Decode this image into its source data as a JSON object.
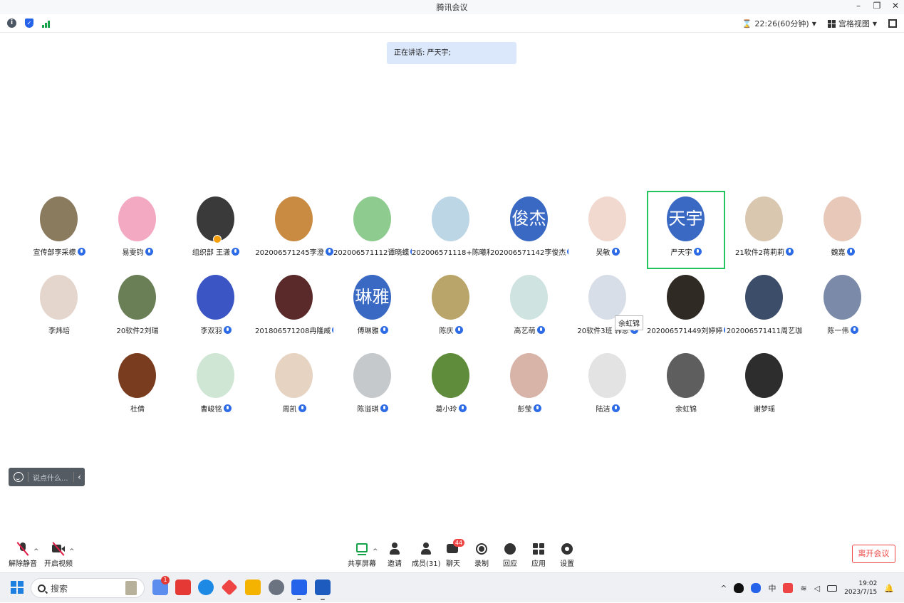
{
  "window": {
    "title": "腾讯会议",
    "controls": [
      "–",
      "❐",
      "✕"
    ]
  },
  "toolbar": {
    "timer": "22:26(60分钟)",
    "view": "宫格视图"
  },
  "speaking": {
    "text": "正在讲话: 严天宇;"
  },
  "participants": [
    {
      "name": "宣传部李采檬",
      "mic": true,
      "avatar_color": "#8a7a5e"
    },
    {
      "name": "易雯钧",
      "mic": true,
      "avatar_color": "#f3a9c2"
    },
    {
      "name": "组织部 王潇",
      "mic": true,
      "avatar_color": "#3a3a3a",
      "host": true
    },
    {
      "name": "202006571245李澄",
      "mic": true,
      "avatar_color": "#c98a42"
    },
    {
      "name": "202006571112谭晓蝶",
      "mic": true,
      "avatar_color": "#8ecb8f"
    },
    {
      "name": "202006571118+陈曦和",
      "mic": false,
      "avatar_color": "#bcd6e6"
    },
    {
      "name": "202006571142李俊杰",
      "mic": true,
      "avatar_text": "俊杰"
    },
    {
      "name": "吴敏",
      "mic": true,
      "avatar_color": "#f2d9cf"
    },
    {
      "name": "严天宇",
      "mic": true,
      "avatar_text": "天宇",
      "active": true
    },
    {
      "name": "21软件2蒋莉莉",
      "mic": true,
      "avatar_color": "#d9c7b0"
    },
    {
      "name": "魏嘉",
      "mic": true,
      "avatar_color": "#e8c8b8"
    },
    {
      "name": "李炜培",
      "mic": false,
      "avatar_color": "#e4d6cc"
    },
    {
      "name": "20软件2刘瑞",
      "mic": false,
      "avatar_color": "#6b7f56"
    },
    {
      "name": "李双羽",
      "mic": true,
      "avatar_color": "#3b56c4"
    },
    {
      "name": "201806571208冉隆威",
      "mic": true,
      "avatar_color": "#5a2a2a"
    },
    {
      "name": "傅琳雅",
      "mic": true,
      "avatar_text": "琳雅"
    },
    {
      "name": "陈庆",
      "mic": true,
      "avatar_color": "#b9a46a"
    },
    {
      "name": "高艺萌",
      "mic": true,
      "avatar_color": "#cfe3e0"
    },
    {
      "name": "20软件3班 韩思",
      "mic": true,
      "avatar_color": "#d8dee8"
    },
    {
      "name": "202006571449刘婷婷",
      "mic": true,
      "avatar_color": "#2f2a24"
    },
    {
      "name": "202006571411周艺珈",
      "mic": false,
      "avatar_color": "#3c4d6a"
    },
    {
      "name": "陈一伟",
      "mic": true,
      "avatar_color": "#7a8aa8"
    },
    {
      "name": "杜倩",
      "mic": false,
      "avatar_color": "#7a3c1e"
    },
    {
      "name": "曹峻铭",
      "mic": true,
      "avatar_color": "#cfe6d4"
    },
    {
      "name": "周凯",
      "mic": true,
      "avatar_color": "#e6d3c2"
    },
    {
      "name": "陈溢琪",
      "mic": true,
      "avatar_color": "#c6c9cc"
    },
    {
      "name": "葛小玲",
      "mic": true,
      "avatar_color": "#5f8c3a"
    },
    {
      "name": "彭莹",
      "mic": true,
      "avatar_color": "#d8b4a8"
    },
    {
      "name": "陆洁",
      "mic": true,
      "avatar_color": "#e3e3e3"
    },
    {
      "name": "余虹锦",
      "mic": false,
      "avatar_color": "#5e5e5e"
    },
    {
      "name": "谢梦瑶",
      "mic": false,
      "avatar_color": "#2d2d2d"
    }
  ],
  "tooltip": {
    "text": "余虹锦"
  },
  "chat": {
    "placeholder": "说点什么..."
  },
  "bottom_toolbar": {
    "unmute": "解除静音",
    "start_video": "开启视频",
    "share_screen": "共享屏幕",
    "invite": "邀请",
    "members": "成员(31)",
    "chat": "聊天",
    "chat_badge": "44",
    "record": "录制",
    "reaction": "回应",
    "apps": "应用",
    "settings": "设置",
    "leave": "离开会议"
  },
  "taskbar": {
    "search_placeholder": "搜索",
    "notif_count": "1",
    "time": "19:02",
    "date": "2023/7/15",
    "ime": "中"
  }
}
